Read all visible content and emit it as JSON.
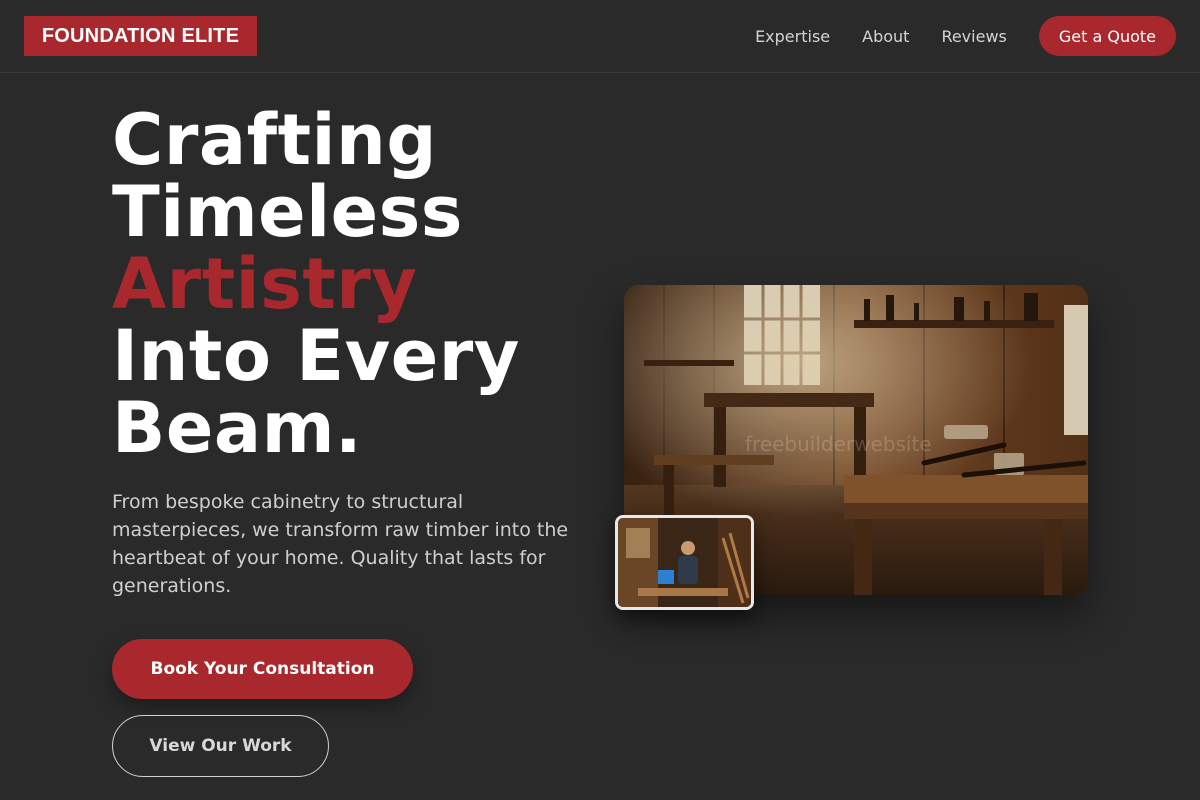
{
  "brand": {
    "name": "FOUNDATION ELITE"
  },
  "nav": {
    "links": [
      "Expertise",
      "About",
      "Reviews"
    ],
    "cta": "Get a Quote"
  },
  "hero": {
    "title_lines": [
      "Crafting",
      "Timeless",
      "Artistry",
      "Into Every",
      "Beam."
    ],
    "accent_line_index": 2,
    "description": "From bespoke cabinetry to structural masterpieces, we transform raw timber into the heartbeat of your home. Quality that lasts for generations.",
    "primary_button": "Book Your Consultation",
    "secondary_button": "View Our Work"
  },
  "images": {
    "main_watermark": "freebuilderwebsite"
  },
  "colors": {
    "background": "#2a2a2a",
    "accent": "#a8282e",
    "text": "#ffffff",
    "muted_text": "#cfcfcf"
  }
}
